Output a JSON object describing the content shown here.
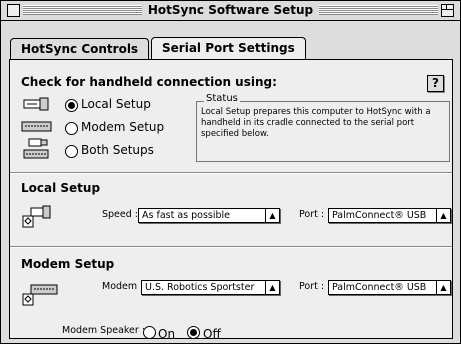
{
  "window": {
    "title": "HotSync Software Setup"
  },
  "tabs": [
    {
      "label": "HotSync Controls"
    },
    {
      "label": "Serial Port Settings"
    }
  ],
  "connection": {
    "heading": "Check for handheld connection using:",
    "options": [
      {
        "label": "Local Setup",
        "selected": true
      },
      {
        "label": "Modem Setup",
        "selected": false
      },
      {
        "label": "Both Setups",
        "selected": false
      }
    ],
    "help_label": "?"
  },
  "status": {
    "title": "Status",
    "text": "Local Setup prepares this computer to HotSync with a handheld in its cradle connected to the serial port specified below."
  },
  "local_setup": {
    "heading": "Local Setup",
    "speed_label": "Speed :",
    "speed_value": "As fast as possible",
    "port_label": "Port :",
    "port_value": "PalmConnect® USB"
  },
  "modem_setup": {
    "heading": "Modem Setup",
    "modem_label": "Modem :",
    "modem_value": "U.S. Robotics Sportster",
    "port_label": "Port :",
    "port_value": "PalmConnect® USB",
    "speaker_label": "Modem Speaker :",
    "speaker_options": [
      {
        "label": "On",
        "selected": false
      },
      {
        "label": "Off",
        "selected": true
      }
    ]
  },
  "icons": [
    "close-box-icon",
    "zoom-box-icon",
    "cradle-icon",
    "modem-icon",
    "both-setups-icon",
    "popup-arrow-icon"
  ]
}
